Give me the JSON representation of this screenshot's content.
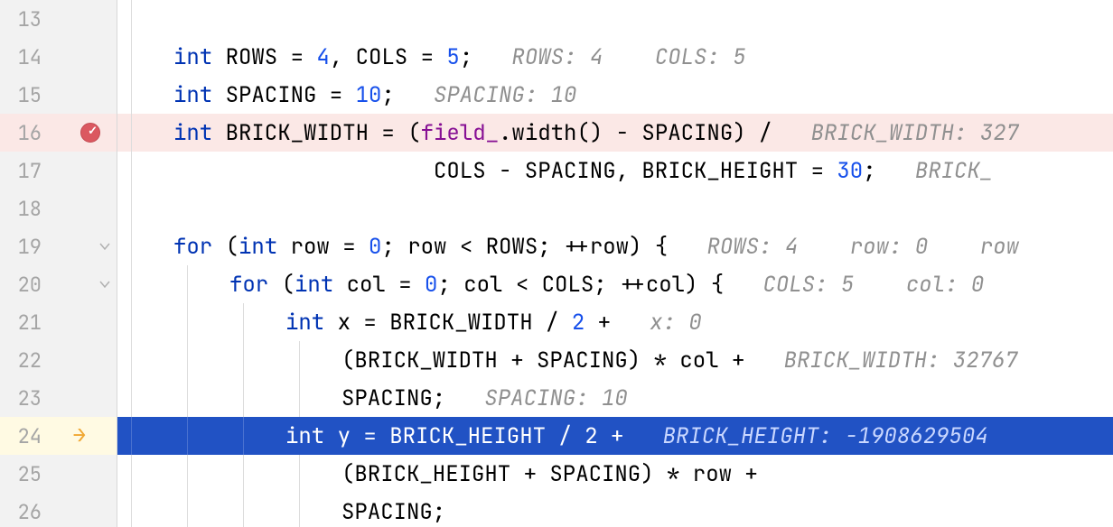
{
  "line_height": 42,
  "gutter": {
    "13": {
      "num": "13"
    },
    "14": {
      "num": "14"
    },
    "15": {
      "num": "15"
    },
    "16": {
      "num": "16",
      "breakpoint": true
    },
    "17": {
      "num": "17"
    },
    "18": {
      "num": "18"
    },
    "19": {
      "num": "19",
      "fold": true
    },
    "20": {
      "num": "20",
      "fold": true
    },
    "21": {
      "num": "21"
    },
    "22": {
      "num": "22"
    },
    "23": {
      "num": "23"
    },
    "24": {
      "num": "24",
      "exec": true
    },
    "25": {
      "num": "25"
    },
    "26": {
      "num": "26"
    }
  },
  "code": {
    "l14": {
      "kw": "int",
      "t1": " ROWS = ",
      "n1": "4",
      "t2": ", COLS = ",
      "n2": "5",
      "t3": ";",
      "hint": "   ROWS: 4    COLS: 5"
    },
    "l15": {
      "kw": "int",
      "t1": " SPACING = ",
      "n1": "10",
      "t2": ";",
      "hint": "   SPACING: 10"
    },
    "l16": {
      "kw": "int",
      "t1": " BRICK_WIDTH = (",
      "fld": "field_",
      "t2": ".width() - SPACING) /",
      "hint": "   BRICK_WIDTH: 327"
    },
    "l17": {
      "t1": "COLS - SPACING, BRICK_HEIGHT = ",
      "n1": "30",
      "t2": ";",
      "hint": "   BRICK_"
    },
    "l19": {
      "kw1": "for",
      "t1": " (",
      "kw2": "int",
      "t2": " row = ",
      "n1": "0",
      "t3": "; row < ROWS; ++row) {",
      "hint": "   ROWS: 4    row: 0    row"
    },
    "l20": {
      "kw1": "for",
      "t1": " (",
      "kw2": "int",
      "t2": " col = ",
      "n1": "0",
      "t3": "; col < COLS; ++col) {",
      "hint": "   COLS: 5    col: 0"
    },
    "l21": {
      "kw": "int",
      "t1": " x = BRICK_WIDTH / ",
      "n1": "2",
      "t2": " +",
      "hint": "   x: 0"
    },
    "l22": {
      "t1": "(BRICK_WIDTH + SPACING) * col +",
      "hint": "   BRICK_WIDTH: 32767"
    },
    "l23": {
      "t1": "SPACING;",
      "hint": "   SPACING: 10"
    },
    "l24": {
      "kw": "int",
      "t1": " y = BRICK_HEIGHT / ",
      "n1": "2",
      "t2": " +",
      "hint": "   BRICK_HEIGHT: -1908629504"
    },
    "l25": {
      "t1": "(BRICK_HEIGHT + SPACING) * row +"
    },
    "l26": {
      "t1": "SPACING;"
    }
  }
}
